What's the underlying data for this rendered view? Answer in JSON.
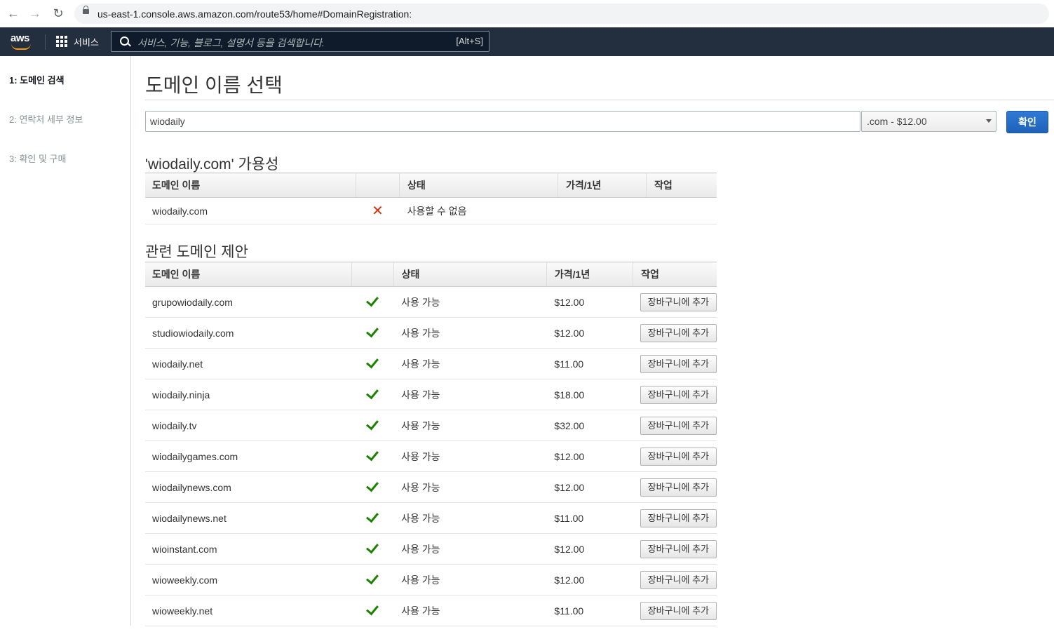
{
  "browser": {
    "url": "us-east-1.console.aws.amazon.com/route53/home#DomainRegistration:"
  },
  "awsnav": {
    "logo": "aws",
    "services_label": "서비스",
    "search_placeholder": "서비스, 기능, 블로그, 설명서 등을 검색합니다.",
    "search_shortcut": "[Alt+S]"
  },
  "sidebar": {
    "steps": [
      {
        "label": "1: 도메인 검색",
        "active": true
      },
      {
        "label": "2: 연락처 세부 정보",
        "active": false
      },
      {
        "label": "3: 확인 및 구매",
        "active": false
      }
    ]
  },
  "main": {
    "title": "도메인 이름 선택",
    "search_value": "wiodaily",
    "tld_selected": ".com - $12.00",
    "confirm_label": "확인"
  },
  "availability": {
    "title": "'wiodaily.com' 가용성",
    "headers": {
      "name": "도메인 이름",
      "status": "상태",
      "price": "가격/1년",
      "action": "작업"
    },
    "row": {
      "name": "wiodaily.com",
      "status": "사용할 수 없음",
      "available": false
    }
  },
  "suggestions": {
    "title": "관련 도메인 제안",
    "headers": {
      "name": "도메인 이름",
      "status": "상태",
      "price": "가격/1년",
      "action": "작업"
    },
    "add_label": "장바구니에 추가",
    "rows": [
      {
        "name": "grupowiodaily.com",
        "status": "사용 가능",
        "price": "$12.00"
      },
      {
        "name": "studiowiodaily.com",
        "status": "사용 가능",
        "price": "$12.00"
      },
      {
        "name": "wiodaily.net",
        "status": "사용 가능",
        "price": "$11.00"
      },
      {
        "name": "wiodaily.ninja",
        "status": "사용 가능",
        "price": "$18.00"
      },
      {
        "name": "wiodaily.tv",
        "status": "사용 가능",
        "price": "$32.00"
      },
      {
        "name": "wiodailygames.com",
        "status": "사용 가능",
        "price": "$12.00"
      },
      {
        "name": "wiodailynews.com",
        "status": "사용 가능",
        "price": "$12.00"
      },
      {
        "name": "wiodailynews.net",
        "status": "사용 가능",
        "price": "$11.00"
      },
      {
        "name": "wioinstant.com",
        "status": "사용 가능",
        "price": "$12.00"
      },
      {
        "name": "wioweekly.com",
        "status": "사용 가능",
        "price": "$12.00"
      },
      {
        "name": "wioweekly.net",
        "status": "사용 가능",
        "price": "$11.00"
      }
    ]
  }
}
